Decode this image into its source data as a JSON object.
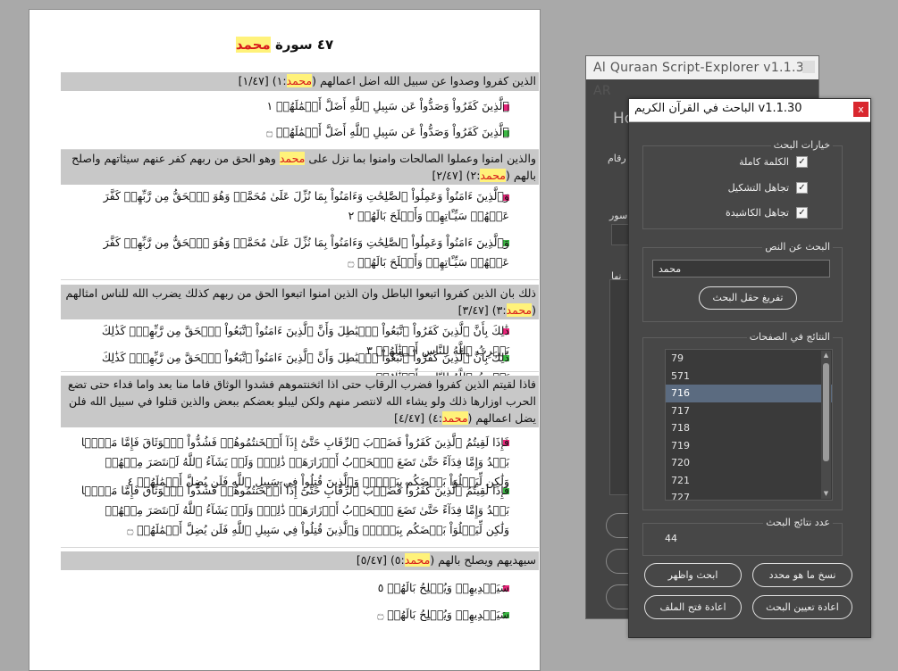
{
  "document": {
    "title_prefix": "٤٧ سورة",
    "title_highlight": "محمد",
    "bands": [
      {
        "pre": "الذين كفروا وصدوا عن سبيل الله اضل اعمالهم (",
        "hl": "محمد",
        "post": ":١) [١/٤٧]"
      },
      {
        "pre": "والذين امنوا وعملوا الصالحات وامنوا بما نزل على ",
        "hl": "محمد",
        "mid": " وهو الحق من ربهم كفر عنهم سيئاتهم واصلح بالهم (",
        "hl2": "محمد",
        "post": ":٢) [٢/٤٧]"
      },
      {
        "pre": "ذلك بان الذين كفروا اتبعوا الباطل وان الذين امنوا اتبعوا الحق من ربهم كذلك يضرب الله للناس امثالهم (",
        "hl": "محمد",
        "post": ":٣) [٣/٤٧]"
      },
      {
        "pre": "فاذا لقيتم الذين كفروا فضرب الرقاب حتى اذا اثخنتموهم فشدوا الوثاق فاما منا بعد واما فداء حتى تضع الحرب اوزارها ذلك ولو يشاء الله لانتصر منهم ولكن ليبلو بعضكم ببعض والذين قتلوا في سبيل الله فلن يضل اعمالهم (",
        "hl": "محمد",
        "post": ":٤) [٤/٤٧]"
      },
      {
        "pre": "سيهديهم ويصلح بالهم (",
        "hl": "محمد",
        "post": ":٥) [٥/٤٧]"
      }
    ],
    "verses": [
      "ٱلَّذِينَ كَفَرُواْ وَصَدُّواْ عَن سَبِيلِ ٱللَّهِ أَضَلَّ أَعۡمَٰلَهُمۡ ١",
      "ٱلَّذِينَ كَفَرُواْ وَصَدُّواْ عَن سَبِيلِ ٱللَّهِ أَضَلَّ أَعۡمَٰلَهُمۡ ۝",
      "وَٱلَّذِينَ ءَامَنُواْ وَعَمِلُواْ ٱلصَّٰلِحَٰتِ وَءَامَنُواْ بِمَا نُزِّلَ عَلَىٰ مُحَمَّدٖ وَهُوَ ٱلۡحَقُّ مِن رَّبِّهِمۡ كَفَّرَ عَنۡهُمۡ سَيِّـَٔاتِهِمۡ وَأَصۡلَحَ بَالَهُمۡ ٢",
      "وَٱلَّذِينَ ءَامَنُواْ وَعَمِلُواْ ٱلصَّٰلِحَٰتِ وَءَامَنُواْ بِمَا نُزِّلَ عَلَىٰ مُحَمَّدٖ وَهُوَ ٱلۡحَقُّ مِن رَّبِّهِمۡ كَفَّرَ عَنۡهُمۡ سَيِّـَٔاتِهِمۡ وَأَصۡلَحَ بَالَهُمۡ ۝",
      "ذَٰلِكَ بِأَنَّ ٱلَّذِينَ كَفَرُواْ ٱتَّبَعُواْ ٱلۡبَٰطِلَ وَأَنَّ ٱلَّذِينَ ءَامَنُواْ ٱتَّبَعُواْ ٱلۡحَقَّ مِن رَّبِّهِمۡۚ كَذَٰلِكَ يَضۡرِبُ ٱللَّهُ لِلنَّاسِ أَمۡثَٰلَهُمۡ ٣",
      "ذَٰلِكَ بِأَنَّ ٱلَّذِينَ كَفَرُواْ ٱتَّبَعُواْ ٱلۡبَٰطِلَ وَأَنَّ ٱلَّذِينَ ءَامَنُواْ ٱتَّبَعُواْ ٱلۡحَقَّ مِن رَّبِّهِمۡۚ كَذَٰلِكَ يَضۡرِبُ ٱللَّهُ لِلنَّاسِ أَمۡثَٰلَهُمۡ ۝",
      "فَإِذَا لَقِيتُمُ ٱلَّذِينَ كَفَرُواْ فَضَرۡبَ ٱلرِّقَابِ حَتَّىٰٓ إِذَآ أَثۡخَنتُمُوهُمۡ فَشُدُّواْ ٱلۡوَثَاقَ فَإِمَّا مَنَّۢا بَعۡدُ وَإِمَّا فِدَآءً حَتَّىٰ تَضَعَ ٱلۡحَرۡبُ أَوۡزَارَهَاۚ ذَٰلِكَۖ وَلَوۡ يَشَآءُ ٱللَّهُ لَٱنتَصَرَ مِنۡهُمۡ وَلَٰكِن لِّيَبۡلُوَاْ بَعۡضَكُم بِبَعۡضٖۗ وَٱلَّذِينَ قُتِلُواْ فِي سَبِيلِ ٱللَّهِ فَلَن يُضِلَّ أَعۡمَٰلَهُمۡ ٤",
      "فَإِذَا لَقِيتُمُ ٱلَّذِينَ كَفَرُواْ فَضَرۡبَ ٱلرِّقَابِ حَتَّىٰٓ إِذَآ أَثۡخَنتُمُوهُمۡ فَشُدُّواْ ٱلۡوَثَاقَ فَإِمَّا مَنَّۢا بَعۡدُ وَإِمَّا فِدَآءً حَتَّىٰ تَضَعَ ٱلۡحَرۡبُ أَوۡزَارَهَاۚ ذَٰلِكَۖ وَلَوۡ يَشَآءُ ٱللَّهُ لَٱنتَصَرَ مِنۡهُمۡ وَلَٰكِن لِّيَبۡلُوَاْ بَعۡضَكُم بِبَعۡضٖۗ وَٱلَّذِينَ قُتِلُواْ فِي سَبِيلِ ٱللَّهِ فَلَن يُضِلَّ أَعۡمَٰلَهُمۡ ۝",
      "سَيَهۡدِيهِمۡ وَيُصۡلِحُ بَالَهُمۡ ٥",
      "سَيَهۡدِيهِمۡ وَيُصۡلِحُ بَالَهُمۡ ۝"
    ]
  },
  "background_window": {
    "title": "Al Quraan Script-Explorer v1.1.37 AR",
    "fragment_ho": "Ho",
    "fragment_numbers": "رقام",
    "fragment_suwar": "سور",
    "fragment_list_header": "نها"
  },
  "dialog": {
    "title": "v1.1.30 الباحث في القرآن الكريم",
    "close_label": "x",
    "options_group_label": "خيارات البحث",
    "option_whole_word": "الكلمة كاملة",
    "option_ignore_diacritics": "تجاهل التشكيل",
    "option_ignore_kashida": "تجاهل الكاشيدة",
    "search_group_label": "البحث عن النص",
    "search_value": "محمد",
    "clear_button": "تفريغ حقل البحث",
    "results_group_label": "النتائج في الصفحات",
    "results": [
      "79",
      "571",
      "716",
      "717",
      "718",
      "719",
      "720",
      "721",
      "727"
    ],
    "selected_result": "716",
    "count_group_label": "عدد نتائج البحث",
    "count_value": "44",
    "btn_copy": "نسخ ما هو محدد",
    "btn_search_show": "ابحث واظهر",
    "btn_reset_search": "اعادة تعيين البحث",
    "btn_reopen_file": "اعادة فتح الملف"
  }
}
